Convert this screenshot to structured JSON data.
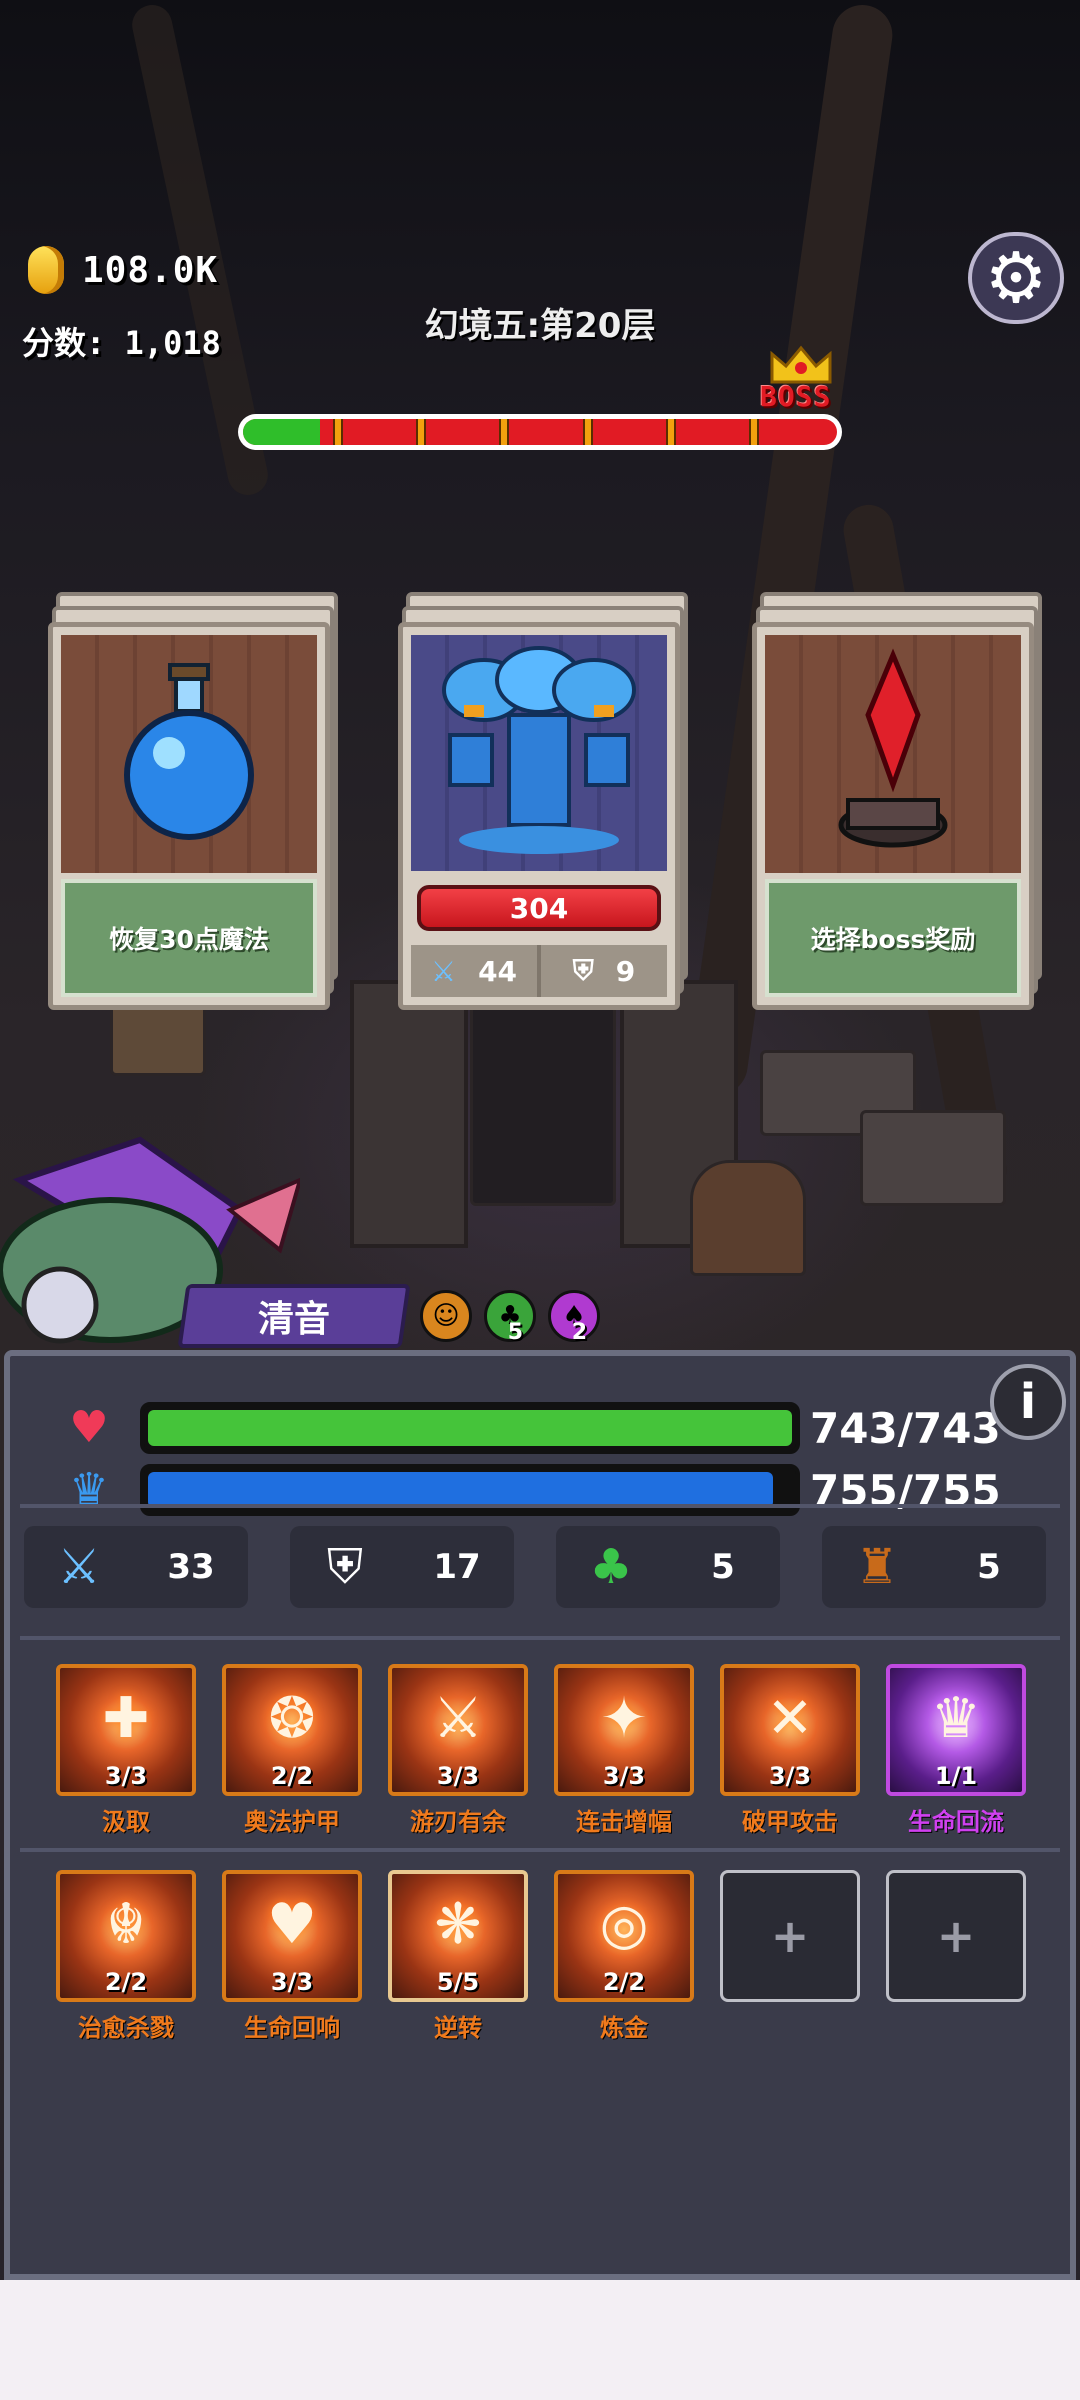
{
  "hud": {
    "coins": "108.0K",
    "score": "分数: 1,018",
    "floor_title": "幻境五:第20层",
    "boss_label": "BOSS",
    "settings_icon": "gear-icon"
  },
  "progress": {
    "fraction": 0.13,
    "segments": 6
  },
  "cards": {
    "left": {
      "label": "恢复30点魔法",
      "art": "mana-potion"
    },
    "center": {
      "hp": "304",
      "attack": "44",
      "defense": "9",
      "art": "ice-tree-monster"
    },
    "right": {
      "label": "选择boss奖励",
      "art": "red-crystal-altar"
    }
  },
  "hero": {
    "name": "清音",
    "buffs": [
      {
        "icon": "figure-buff-icon",
        "count": "",
        "color": "#d9861e"
      },
      {
        "icon": "mushroom-buff-icon",
        "count": "5",
        "color": "#3aa43a"
      },
      {
        "icon": "mushroom-debuff-icon",
        "count": "2",
        "color": "#b03ad0"
      }
    ]
  },
  "vitals": {
    "hp": {
      "text": "743/743",
      "fraction": 1.0,
      "color": "#45c43a"
    },
    "mp": {
      "text": "755/755",
      "fraction": 0.97,
      "color": "#1f6fe0"
    }
  },
  "stats": {
    "attack": "33",
    "defense": "17",
    "luck": "5",
    "bag": "5"
  },
  "skills_row1": [
    {
      "name": "汲取",
      "count": "3/3",
      "glyph": "✚",
      "style": "orange"
    },
    {
      "name": "奥法护甲",
      "count": "2/2",
      "glyph": "❂",
      "style": "orange"
    },
    {
      "name": "游刃有余",
      "count": "3/3",
      "glyph": "⚔",
      "style": "orange"
    },
    {
      "name": "连击增幅",
      "count": "3/3",
      "glyph": "✦",
      "style": "orange"
    },
    {
      "name": "破甲攻击",
      "count": "3/3",
      "glyph": "✕",
      "style": "orange"
    },
    {
      "name": "生命回流",
      "count": "1/1",
      "glyph": "♛",
      "style": "purple"
    }
  ],
  "skills_row2": [
    {
      "name": "治愈杀戮",
      "count": "2/2",
      "glyph": "☬",
      "style": "orange"
    },
    {
      "name": "生命回响",
      "count": "3/3",
      "glyph": "♥",
      "style": "orange"
    },
    {
      "name": "逆转",
      "count": "5/5",
      "glyph": "❋",
      "style": "gold"
    },
    {
      "name": "炼金",
      "count": "2/2",
      "glyph": "◎",
      "style": "orange"
    }
  ],
  "empty_slot_label": "+"
}
